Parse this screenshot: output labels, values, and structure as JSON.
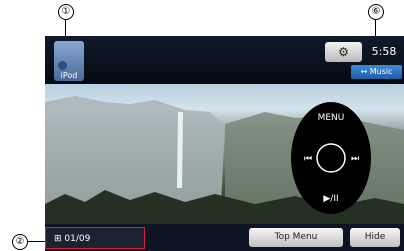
{
  "callouts": {
    "one": "①",
    "two": "②",
    "six": "⑥"
  },
  "header": {
    "source_label": "iPod",
    "settings_icon_text": "⚙",
    "clock": "5:58",
    "music_label": "↔ Music"
  },
  "controls": {
    "menu": "MENU",
    "prev": "⏮",
    "next": "⏭",
    "play_pause": "▶/II"
  },
  "footer": {
    "track_prefix": "⊞",
    "track_counter": "01/09",
    "top_menu": "Top Menu",
    "hide": "Hide"
  },
  "colors": {
    "accent_red": "#d21d3b",
    "music_blue": "#2f75c5"
  }
}
